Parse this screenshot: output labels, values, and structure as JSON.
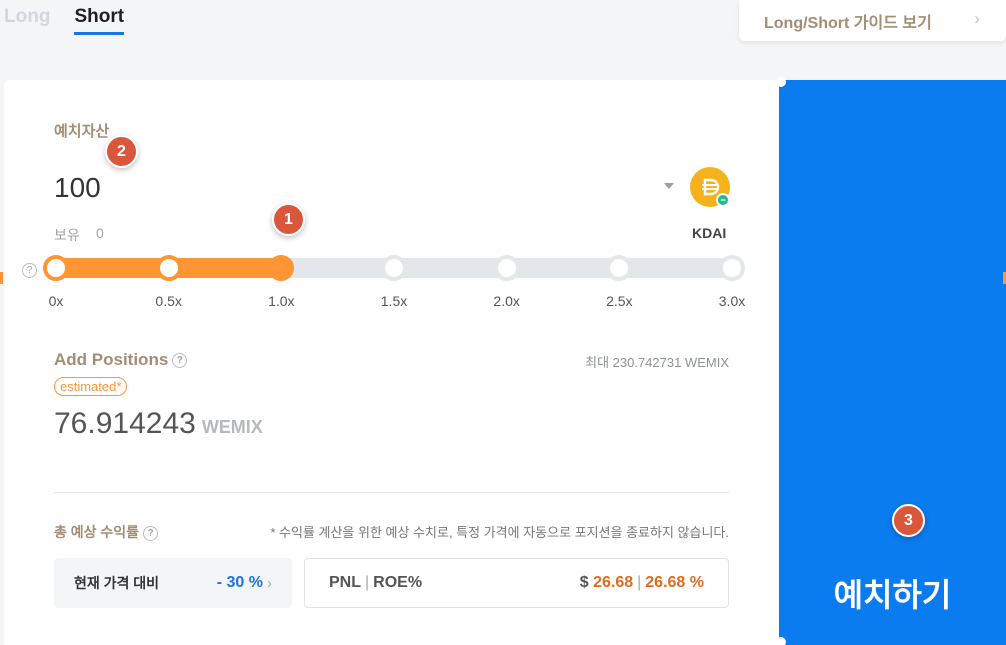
{
  "tabs": [
    {
      "label": "Long",
      "active": false
    },
    {
      "label": "Short",
      "active": true
    }
  ],
  "guide": {
    "label": "Long/Short 가이드 보기",
    "chevron": "›"
  },
  "deposit": {
    "label": "예치자산",
    "amount": "100",
    "hold_label": "보유",
    "hold_value": "0",
    "token": "KDAI"
  },
  "slider": {
    "ticks": [
      "0x",
      "0.5x",
      "1.0x",
      "1.5x",
      "2.0x",
      "2.5x",
      "3.0x"
    ],
    "selected_index": 2
  },
  "badges": [
    "1",
    "2",
    "3"
  ],
  "positions": {
    "title": "Add Positions",
    "max": "최대 230.742731 WEMIX",
    "estimated": "estimated*",
    "value": "76.914243",
    "unit": "WEMIX"
  },
  "roi": {
    "title": "총 예상 수익률",
    "note": "* 수익률 계산을 위한 예상 수치로, 특정 가격에 자동으로 포지션을 종료하지 않습니다.",
    "compare_label": "현재 가격 대비",
    "compare_value": "- 30 %",
    "pnl_label": "PNL",
    "roe_label": "ROE%",
    "pnl_dollar": "$",
    "pnl_value": "26.68",
    "roe_value": "26.68 %"
  },
  "action": {
    "label": "예치하기"
  },
  "colors": {
    "accent": "#ff9533",
    "primary": "#0a7cf0",
    "badge": "#d9573b"
  }
}
